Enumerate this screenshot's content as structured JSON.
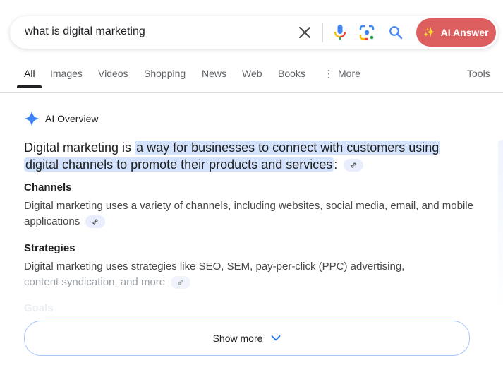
{
  "search": {
    "query": "what is digital marketing",
    "clear_icon": "close-icon",
    "mic_icon": "microphone-icon",
    "lens_icon": "camera-lens-icon",
    "search_icon": "search-icon",
    "ai_answer_label": "AI Answer",
    "ai_answer_color": "#dc5e5e"
  },
  "tabs": [
    {
      "label": "All",
      "active": true
    },
    {
      "label": "Images"
    },
    {
      "label": "Videos"
    },
    {
      "label": "Shopping"
    },
    {
      "label": "News"
    },
    {
      "label": "Web"
    },
    {
      "label": "Books"
    },
    {
      "label": "More",
      "icon": "more-vert-icon"
    },
    {
      "label": "Tools"
    }
  ],
  "ai_overview": {
    "header": "AI Overview",
    "summary_prefix": "Digital marketing is ",
    "summary_highlight": "a way for businesses to connect with customers using digital channels to promote their products and services",
    "summary_suffix": ":",
    "highlight_color": "#d3e3fd",
    "sections": [
      {
        "title": "Channels",
        "body": "Digital marketing uses a variety of channels, including websites, social media, email, and mobile applications"
      },
      {
        "title": "Strategies",
        "body_line1": "Digital marketing uses strategies like SEO, SEM, pay-per-click (PPC) advertising,",
        "body_line2": "content syndication, and more"
      },
      {
        "title": "Goals"
      }
    ],
    "show_more_label": "Show more"
  }
}
